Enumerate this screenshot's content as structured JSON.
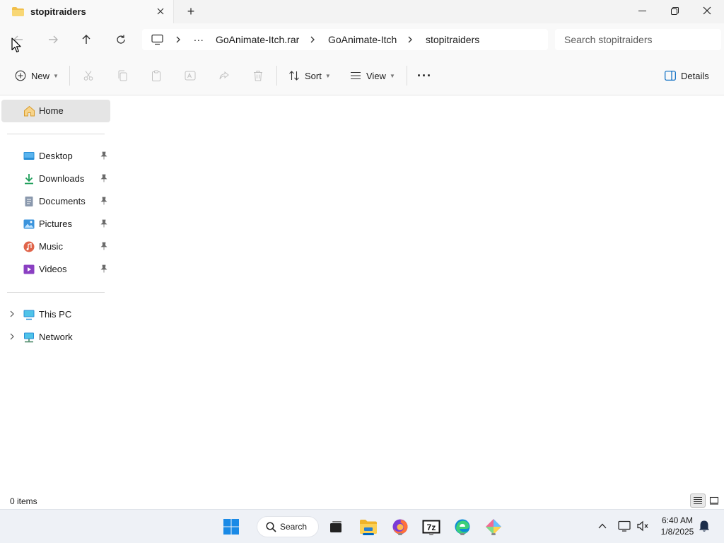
{
  "window": {
    "tab_title": "stopitraiders",
    "new_tab_symbol": "+",
    "minimize_symbol": "—",
    "maximize_symbol": "❐",
    "close_symbol": "✕"
  },
  "address": {
    "breadcrumb_overflow": "...",
    "breadcrumbs": [
      "GoAnimate-Itch.rar",
      "GoAnimate-Itch",
      "stopitraiders"
    ],
    "search_placeholder": "Search stopitraiders"
  },
  "commands": {
    "new_label": "New",
    "sort_label": "Sort",
    "view_label": "View",
    "more_label": "···",
    "details_label": "Details"
  },
  "sidebar": {
    "home": "Home",
    "quick_access": [
      {
        "label": "Desktop",
        "icon": "desktop-icon"
      },
      {
        "label": "Downloads",
        "icon": "downloads-icon"
      },
      {
        "label": "Documents",
        "icon": "documents-icon"
      },
      {
        "label": "Pictures",
        "icon": "pictures-icon"
      },
      {
        "label": "Music",
        "icon": "music-icon"
      },
      {
        "label": "Videos",
        "icon": "videos-icon"
      }
    ],
    "locations": [
      {
        "label": "This PC",
        "icon": "this-pc-icon"
      },
      {
        "label": "Network",
        "icon": "network-icon"
      }
    ]
  },
  "status": {
    "item_count": "0 items"
  },
  "taskbar": {
    "search_label": "Search",
    "time": "6:40 AM",
    "date": "1/8/2025"
  },
  "colors": {
    "accent": "#0067c0",
    "folder_yellow": "#f2c04b",
    "sidebar_selected": "#e5e5e5"
  }
}
